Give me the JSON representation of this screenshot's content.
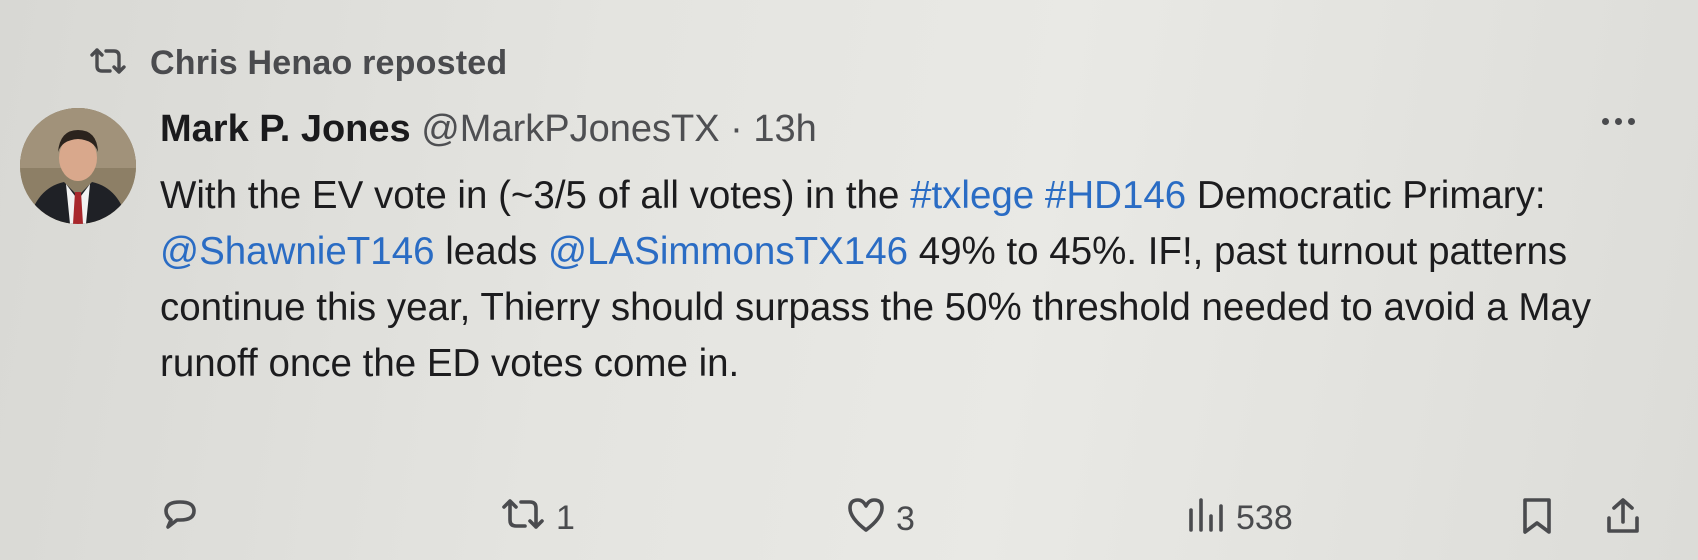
{
  "repost": {
    "label": "Chris Henao reposted",
    "icon": "repost-icon"
  },
  "author": {
    "name": "Mark P. Jones",
    "handle": "@MarkPJonesTX",
    "separator": "·",
    "time": "13h"
  },
  "tweet": {
    "p1_a": "With the EV vote in (~3/5 of all votes) in the ",
    "p1_tag1": "#txlege",
    "p1_space": " ",
    "p1_tag2": "#HD146",
    "p1_b": " Democratic Primary:",
    "p2_mention1": "@ShawnieT146",
    "p2_a": " leads ",
    "p2_mention2": "@LASimmonsTX146",
    "p2_b": " 49% to 45%. IF!, past turnout patterns continue this year, Thierry should surpass the 50% threshold needed to avoid a May runoff once the ED votes come in."
  },
  "actions": {
    "reply_count": "",
    "repost_count": "1",
    "like_count": "3",
    "views_count": "538"
  },
  "colors": {
    "link": "#2a6cc4",
    "text": "#1c1c1e",
    "muted": "#4a4b4e"
  }
}
